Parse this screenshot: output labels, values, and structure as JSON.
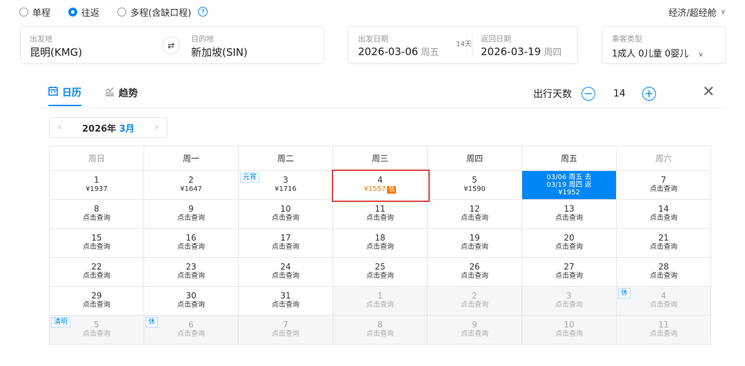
{
  "trip_types": [
    {
      "label": "单程",
      "selected": false
    },
    {
      "label": "往返",
      "selected": true
    },
    {
      "label": "多程(含缺口程)",
      "selected": false
    }
  ],
  "help_glyph": "?",
  "cabin": {
    "label": "经济/超经舱",
    "chevron": "∨"
  },
  "origin": {
    "label": "出发地",
    "value": "昆明(KMG)"
  },
  "destination": {
    "label": "目的地",
    "value": "新加坡(SIN)"
  },
  "swap_glyph": "⇄",
  "depart": {
    "label": "出发日期",
    "date": "2026-03-06",
    "weekday": "周五"
  },
  "trip_days_pill": "14天",
  "return": {
    "label": "返回日期",
    "date": "2026-03-19",
    "weekday": "周四"
  },
  "passengers": {
    "label": "乘客类型",
    "value": "1成人  0儿童  0婴儿",
    "chevron": "∨"
  },
  "tabs": [
    {
      "label": "日历",
      "icon": "calendar-icon",
      "glyph": "📅",
      "active": true
    },
    {
      "label": "趋势",
      "icon": "trend-chart-icon",
      "glyph": "📈",
      "active": false
    }
  ],
  "days_control": {
    "label": "出行天数",
    "value": "14",
    "minus": "−",
    "plus": "+"
  },
  "close_glyph": "✕",
  "month_nav": {
    "prev": "‹",
    "year": "2026年",
    "month": "3月",
    "next": "›"
  },
  "weekdays": [
    "周日",
    "周一",
    "周二",
    "周三",
    "周四",
    "周五",
    "周六"
  ],
  "low_badge": "低",
  "weeks": [
    [
      {
        "d": "1",
        "p": "¥1937"
      },
      {
        "d": "2",
        "p": "¥1647"
      },
      {
        "d": "3",
        "p": "¥1716",
        "tag": "元宵"
      },
      {
        "d": "4",
        "p": "¥1557",
        "low": true
      },
      {
        "d": "5",
        "p": "¥1590"
      },
      {
        "sel": true,
        "lines": [
          "03/06 周五 去",
          "03/19 周四 返",
          "¥1952"
        ]
      },
      {
        "d": "7",
        "p": "点击查询"
      }
    ],
    [
      {
        "d": "8",
        "p": "点击查询"
      },
      {
        "d": "9",
        "p": "点击查询"
      },
      {
        "d": "10",
        "p": "点击查询"
      },
      {
        "d": "11",
        "p": "点击查询"
      },
      {
        "d": "12",
        "p": "点击查询"
      },
      {
        "d": "13",
        "p": "点击查询"
      },
      {
        "d": "14",
        "p": "点击查询"
      }
    ],
    [
      {
        "d": "15",
        "p": "点击查询"
      },
      {
        "d": "16",
        "p": "点击查询"
      },
      {
        "d": "17",
        "p": "点击查询"
      },
      {
        "d": "18",
        "p": "点击查询"
      },
      {
        "d": "19",
        "p": "点击查询"
      },
      {
        "d": "20",
        "p": "点击查询"
      },
      {
        "d": "21",
        "p": "点击查询"
      }
    ],
    [
      {
        "d": "22",
        "p": "点击查询"
      },
      {
        "d": "23",
        "p": "点击查询"
      },
      {
        "d": "24",
        "p": "点击查询"
      },
      {
        "d": "25",
        "p": "点击查询"
      },
      {
        "d": "26",
        "p": "点击查询"
      },
      {
        "d": "27",
        "p": "点击查询"
      },
      {
        "d": "28",
        "p": "点击查询"
      }
    ],
    [
      {
        "d": "29",
        "p": "点击查询"
      },
      {
        "d": "30",
        "p": "点击查询"
      },
      {
        "d": "31",
        "p": "点击查询"
      },
      {
        "d": "1",
        "p": "点击查询",
        "muted": true
      },
      {
        "d": "2",
        "p": "点击查询",
        "muted": true
      },
      {
        "d": "3",
        "p": "点击查询",
        "muted": true
      },
      {
        "d": "4",
        "p": "点击查询",
        "muted": true,
        "tag": "休"
      }
    ],
    [
      {
        "d": "5",
        "p": "点击查询",
        "muted": true,
        "tag": "清明"
      },
      {
        "d": "6",
        "p": "点击查询",
        "muted": true,
        "tag": "休"
      },
      {
        "d": "7",
        "p": "点击查询",
        "muted": true
      },
      {
        "d": "8",
        "p": "点击查询",
        "muted": true
      },
      {
        "d": "9",
        "p": "点击查询",
        "muted": true
      },
      {
        "d": "10",
        "p": "点击查询",
        "muted": true
      },
      {
        "d": "11",
        "p": "点击查询",
        "muted": true
      }
    ]
  ]
}
